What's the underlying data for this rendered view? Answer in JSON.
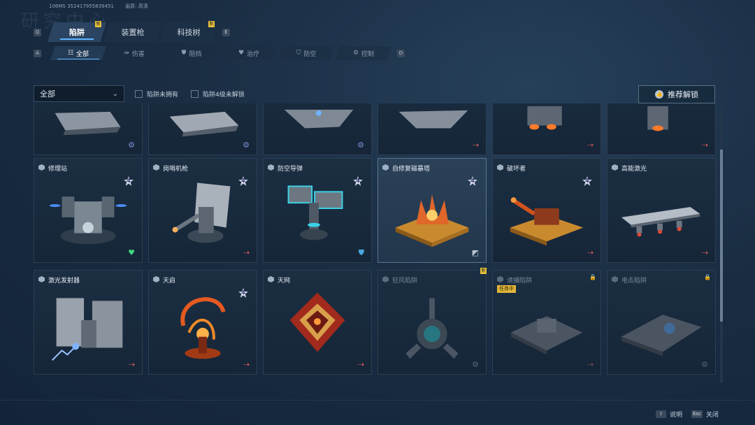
{
  "header": {
    "build_id": "106MS 352417955839451",
    "quality": "画质: 高清",
    "bg_title": "研究中心"
  },
  "keys": {
    "prev_tab": "Q",
    "next_tab": "E",
    "prev_sub": "A",
    "next_sub": "D"
  },
  "tabs": [
    {
      "label": "陷阱",
      "active": true,
      "new": true
    },
    {
      "label": "装置枪",
      "active": false,
      "new": false
    },
    {
      "label": "科技树",
      "active": false,
      "new": true
    }
  ],
  "new_badge": "新",
  "subtabs": [
    {
      "label": "全部",
      "icon": "grid-icon"
    },
    {
      "label": "伤害",
      "icon": "damage-icon"
    },
    {
      "label": "阻挡",
      "icon": "block-icon"
    },
    {
      "label": "治疗",
      "icon": "heal-icon"
    },
    {
      "label": "防空",
      "icon": "antiair-icon"
    },
    {
      "label": "控制",
      "icon": "control-icon"
    }
  ],
  "filter": {
    "select_value": "全部",
    "check_unowned": "陷阱未拥有",
    "check_level4": "陷阱4级未解锁"
  },
  "recommend_label": "推荐解锁",
  "top_row_actions": [
    "gear",
    "gear",
    "gear",
    "arrow",
    "arrow",
    "arrow"
  ],
  "items": [
    {
      "name": "修理站",
      "level": "4",
      "action": "heart",
      "selected": false,
      "locked": false
    },
    {
      "name": "岗哨机枪",
      "level": "4",
      "action": "arrow",
      "selected": false,
      "locked": false
    },
    {
      "name": "防空导弹",
      "level": "4",
      "action": "shield",
      "selected": false,
      "locked": false
    },
    {
      "name": "自修复磁暴塔",
      "level": "4",
      "action": "check",
      "selected": true,
      "locked": false
    },
    {
      "name": "破坏者",
      "level": "4",
      "action": "arrow",
      "selected": false,
      "locked": false
    },
    {
      "name": "高能激光",
      "level": "",
      "action": "arrow",
      "selected": false,
      "locked": false
    },
    {
      "name": "激光发射器",
      "level": "",
      "action": "arrow",
      "selected": false,
      "locked": false
    },
    {
      "name": "天启",
      "level": "4",
      "action": "arrow",
      "selected": false,
      "locked": false
    },
    {
      "name": "天网",
      "level": "",
      "action": "arrow",
      "selected": false,
      "locked": false
    },
    {
      "name": "狂风陷阱",
      "level": "",
      "action": "gear-dim",
      "selected": false,
      "locked": true,
      "new": true
    },
    {
      "name": "诱捕陷阱",
      "level": "",
      "action": "arrow",
      "selected": false,
      "locked": true,
      "lock_icon": true,
      "mission": "任务中"
    },
    {
      "name": "电击陷阱",
      "level": "",
      "action": "gear-dim",
      "selected": false,
      "locked": true,
      "lock_icon": true
    }
  ],
  "footer": {
    "help_key": "I",
    "help_label": "说明",
    "close_key": "Esc",
    "close_label": "关闭"
  },
  "colors": {
    "accent": "#5fb4ff",
    "badge": "#e8c23c",
    "arrow": "#e15a5a"
  }
}
